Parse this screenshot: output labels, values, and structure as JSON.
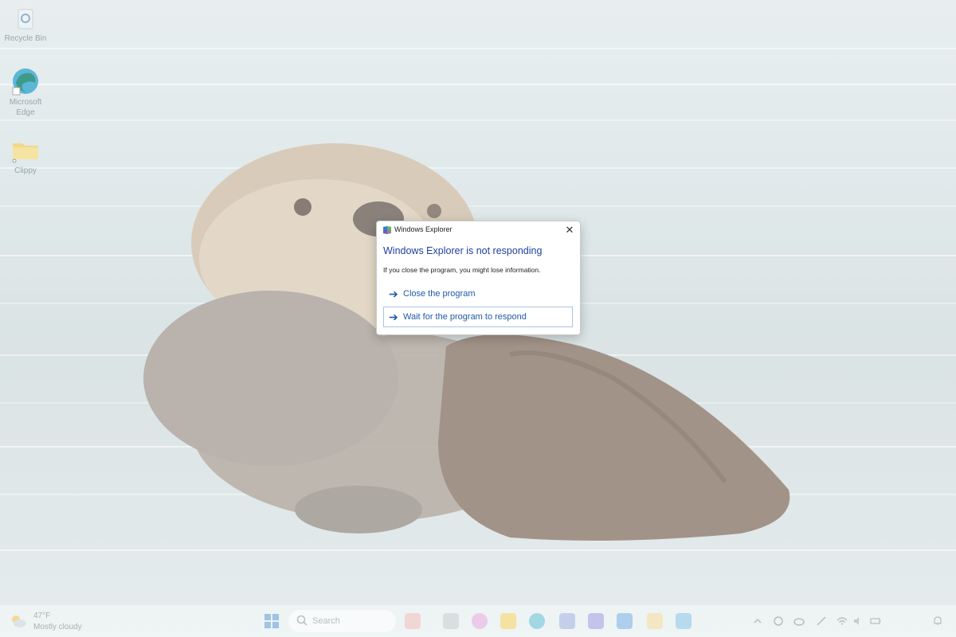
{
  "desktop": {
    "icons": [
      {
        "label": "Recycle Bin",
        "icon": "recycle-bin-icon"
      },
      {
        "label": "Microsoft\nEdge",
        "icon": "edge-icon"
      },
      {
        "label": "Clippy",
        "icon": "folder-icon"
      }
    ]
  },
  "dialog": {
    "title": "Windows Explorer",
    "heading": "Windows Explorer is not responding",
    "message": "If you close the program, you might lose information.",
    "close_label": "✕",
    "commands": [
      {
        "label": "Close the program"
      },
      {
        "label": "Wait for the program to respond"
      }
    ]
  },
  "taskbar": {
    "weather": {
      "temp": "47°F",
      "condition": "Mostly cloudy"
    },
    "search_placeholder": "Search",
    "apps": [
      "copilot",
      "file-explorer",
      "edge",
      "store",
      "teams",
      "outlook",
      "paint",
      "photos"
    ],
    "tray": [
      "chevron-up",
      "network",
      "cloud",
      "pen",
      "wifi",
      "volume",
      "battery",
      "notifications"
    ]
  },
  "colors": {
    "accent": "#1e5aa8",
    "heading": "#1f3fa0"
  }
}
